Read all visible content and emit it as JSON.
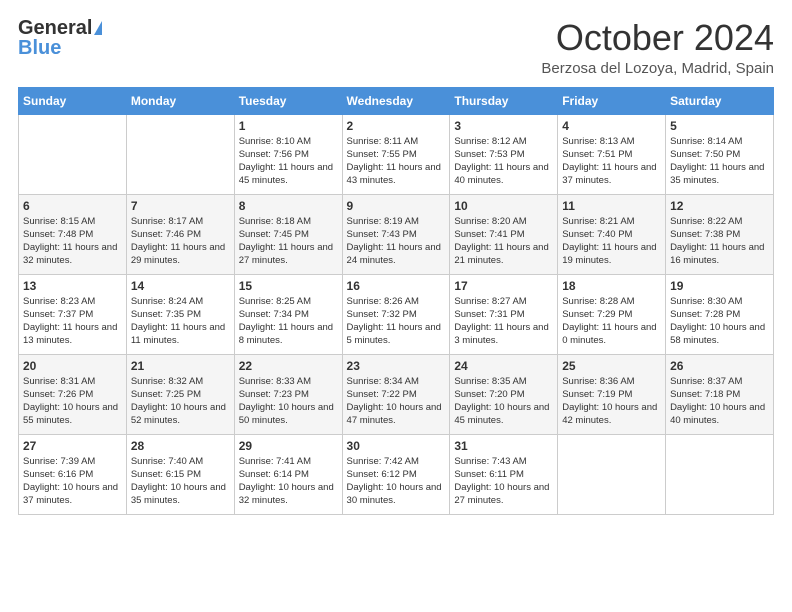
{
  "logo": {
    "general": "General",
    "blue": "Blue"
  },
  "title": {
    "month": "October 2024",
    "location": "Berzosa del Lozoya, Madrid, Spain"
  },
  "weekdays": [
    "Sunday",
    "Monday",
    "Tuesday",
    "Wednesday",
    "Thursday",
    "Friday",
    "Saturday"
  ],
  "weeks": [
    [
      {
        "day": "",
        "info": ""
      },
      {
        "day": "",
        "info": ""
      },
      {
        "day": "1",
        "info": "Sunrise: 8:10 AM\nSunset: 7:56 PM\nDaylight: 11 hours and 45 minutes."
      },
      {
        "day": "2",
        "info": "Sunrise: 8:11 AM\nSunset: 7:55 PM\nDaylight: 11 hours and 43 minutes."
      },
      {
        "day": "3",
        "info": "Sunrise: 8:12 AM\nSunset: 7:53 PM\nDaylight: 11 hours and 40 minutes."
      },
      {
        "day": "4",
        "info": "Sunrise: 8:13 AM\nSunset: 7:51 PM\nDaylight: 11 hours and 37 minutes."
      },
      {
        "day": "5",
        "info": "Sunrise: 8:14 AM\nSunset: 7:50 PM\nDaylight: 11 hours and 35 minutes."
      }
    ],
    [
      {
        "day": "6",
        "info": "Sunrise: 8:15 AM\nSunset: 7:48 PM\nDaylight: 11 hours and 32 minutes."
      },
      {
        "day": "7",
        "info": "Sunrise: 8:17 AM\nSunset: 7:46 PM\nDaylight: 11 hours and 29 minutes."
      },
      {
        "day": "8",
        "info": "Sunrise: 8:18 AM\nSunset: 7:45 PM\nDaylight: 11 hours and 27 minutes."
      },
      {
        "day": "9",
        "info": "Sunrise: 8:19 AM\nSunset: 7:43 PM\nDaylight: 11 hours and 24 minutes."
      },
      {
        "day": "10",
        "info": "Sunrise: 8:20 AM\nSunset: 7:41 PM\nDaylight: 11 hours and 21 minutes."
      },
      {
        "day": "11",
        "info": "Sunrise: 8:21 AM\nSunset: 7:40 PM\nDaylight: 11 hours and 19 minutes."
      },
      {
        "day": "12",
        "info": "Sunrise: 8:22 AM\nSunset: 7:38 PM\nDaylight: 11 hours and 16 minutes."
      }
    ],
    [
      {
        "day": "13",
        "info": "Sunrise: 8:23 AM\nSunset: 7:37 PM\nDaylight: 11 hours and 13 minutes."
      },
      {
        "day": "14",
        "info": "Sunrise: 8:24 AM\nSunset: 7:35 PM\nDaylight: 11 hours and 11 minutes."
      },
      {
        "day": "15",
        "info": "Sunrise: 8:25 AM\nSunset: 7:34 PM\nDaylight: 11 hours and 8 minutes."
      },
      {
        "day": "16",
        "info": "Sunrise: 8:26 AM\nSunset: 7:32 PM\nDaylight: 11 hours and 5 minutes."
      },
      {
        "day": "17",
        "info": "Sunrise: 8:27 AM\nSunset: 7:31 PM\nDaylight: 11 hours and 3 minutes."
      },
      {
        "day": "18",
        "info": "Sunrise: 8:28 AM\nSunset: 7:29 PM\nDaylight: 11 hours and 0 minutes."
      },
      {
        "day": "19",
        "info": "Sunrise: 8:30 AM\nSunset: 7:28 PM\nDaylight: 10 hours and 58 minutes."
      }
    ],
    [
      {
        "day": "20",
        "info": "Sunrise: 8:31 AM\nSunset: 7:26 PM\nDaylight: 10 hours and 55 minutes."
      },
      {
        "day": "21",
        "info": "Sunrise: 8:32 AM\nSunset: 7:25 PM\nDaylight: 10 hours and 52 minutes."
      },
      {
        "day": "22",
        "info": "Sunrise: 8:33 AM\nSunset: 7:23 PM\nDaylight: 10 hours and 50 minutes."
      },
      {
        "day": "23",
        "info": "Sunrise: 8:34 AM\nSunset: 7:22 PM\nDaylight: 10 hours and 47 minutes."
      },
      {
        "day": "24",
        "info": "Sunrise: 8:35 AM\nSunset: 7:20 PM\nDaylight: 10 hours and 45 minutes."
      },
      {
        "day": "25",
        "info": "Sunrise: 8:36 AM\nSunset: 7:19 PM\nDaylight: 10 hours and 42 minutes."
      },
      {
        "day": "26",
        "info": "Sunrise: 8:37 AM\nSunset: 7:18 PM\nDaylight: 10 hours and 40 minutes."
      }
    ],
    [
      {
        "day": "27",
        "info": "Sunrise: 7:39 AM\nSunset: 6:16 PM\nDaylight: 10 hours and 37 minutes."
      },
      {
        "day": "28",
        "info": "Sunrise: 7:40 AM\nSunset: 6:15 PM\nDaylight: 10 hours and 35 minutes."
      },
      {
        "day": "29",
        "info": "Sunrise: 7:41 AM\nSunset: 6:14 PM\nDaylight: 10 hours and 32 minutes."
      },
      {
        "day": "30",
        "info": "Sunrise: 7:42 AM\nSunset: 6:12 PM\nDaylight: 10 hours and 30 minutes."
      },
      {
        "day": "31",
        "info": "Sunrise: 7:43 AM\nSunset: 6:11 PM\nDaylight: 10 hours and 27 minutes."
      },
      {
        "day": "",
        "info": ""
      },
      {
        "day": "",
        "info": ""
      }
    ]
  ]
}
